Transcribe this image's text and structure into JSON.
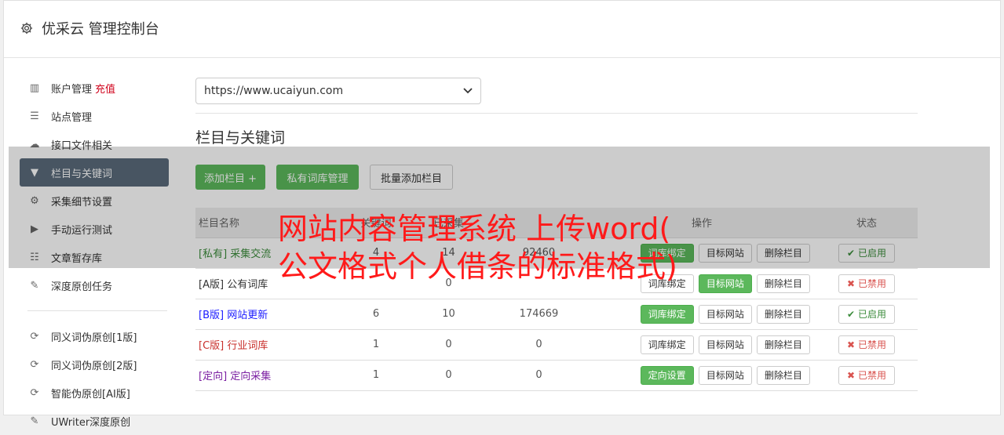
{
  "header": {
    "title": "优采云 管理控制台",
    "icon": "gear-icon"
  },
  "sidebar": {
    "items": [
      {
        "label": "账户管理",
        "extra": "充值",
        "icon": "bar-chart-icon"
      },
      {
        "label": "站点管理",
        "icon": "server-icon"
      },
      {
        "label": "接口文件相关",
        "icon": "cloud-upload-icon"
      },
      {
        "label": "栏目与关键词",
        "icon": "filter-icon",
        "active": true
      },
      {
        "label": "采集细节设置",
        "icon": "cogs-icon"
      },
      {
        "label": "手动运行测试",
        "icon": "play-circle-icon"
      },
      {
        "label": "文章暂存库",
        "icon": "database-icon"
      },
      {
        "label": "深度原创任务",
        "icon": "edit-icon"
      }
    ],
    "tools": [
      {
        "label": "同义词伪原创[1版]",
        "icon": "refresh-icon"
      },
      {
        "label": "同义词伪原创[2版]",
        "icon": "refresh-icon"
      },
      {
        "label": "智能伪原创[AI版]",
        "icon": "refresh-icon"
      },
      {
        "label": "UWriter深度原创",
        "icon": "edit-icon"
      }
    ]
  },
  "site_select": {
    "value": "https://www.ucaiyun.com"
  },
  "section": {
    "title": "栏目与关键词"
  },
  "toolbar": {
    "add_label": "添加栏目 +",
    "private_label": "私有词库管理",
    "batch_label": "批量添加栏目"
  },
  "table": {
    "headers": [
      "栏目名称",
      "关键词",
      "已采集",
      "操作",
      "状态"
    ],
    "rows": [
      {
        "tag": "[私有]",
        "name": "采集交流",
        "c1": "4",
        "c2": "14",
        "c3": "92460",
        "op1": "词库绑定",
        "op1_green": true,
        "op2": "目标网站",
        "op3": "删除栏目",
        "status": "已启用",
        "on": true,
        "color": "#3c8c3c"
      },
      {
        "tag": "[A版]",
        "name": "公有词库",
        "c1": "",
        "c2": "0",
        "c3": "",
        "op1": "词库绑定",
        "op1_green": false,
        "op2": "目标网站",
        "op2_green": true,
        "op3": "删除栏目",
        "status": "已禁用",
        "on": false,
        "color": "#333333"
      },
      {
        "tag": "[B版]",
        "name": "网站更新",
        "c1": "6",
        "c2": "10",
        "c3": "174669",
        "op1": "词库绑定",
        "op1_green": true,
        "op2": "目标网站",
        "op3": "删除栏目",
        "status": "已启用",
        "on": true,
        "color": "#1a1aff"
      },
      {
        "tag": "[C版]",
        "name": "行业词库",
        "c1": "1",
        "c2": "0",
        "c3": "0",
        "op1": "词库绑定",
        "op1_green": false,
        "op2": "目标网站",
        "op3": "删除栏目",
        "status": "已禁用",
        "on": false,
        "color": "#c9302c"
      },
      {
        "tag": "[定向]",
        "name": "定向采集",
        "c1": "1",
        "c2": "0",
        "c3": "0",
        "op1": "定向设置",
        "op1_green": true,
        "op2": "目标网站",
        "op3": "删除栏目",
        "status": "已禁用",
        "on": false,
        "color": "#7b1fa2"
      }
    ]
  },
  "overlay_title": {
    "line1": "网站内容管理系统 上传word(",
    "line2": "公文格式个人借条的标准格式)"
  }
}
